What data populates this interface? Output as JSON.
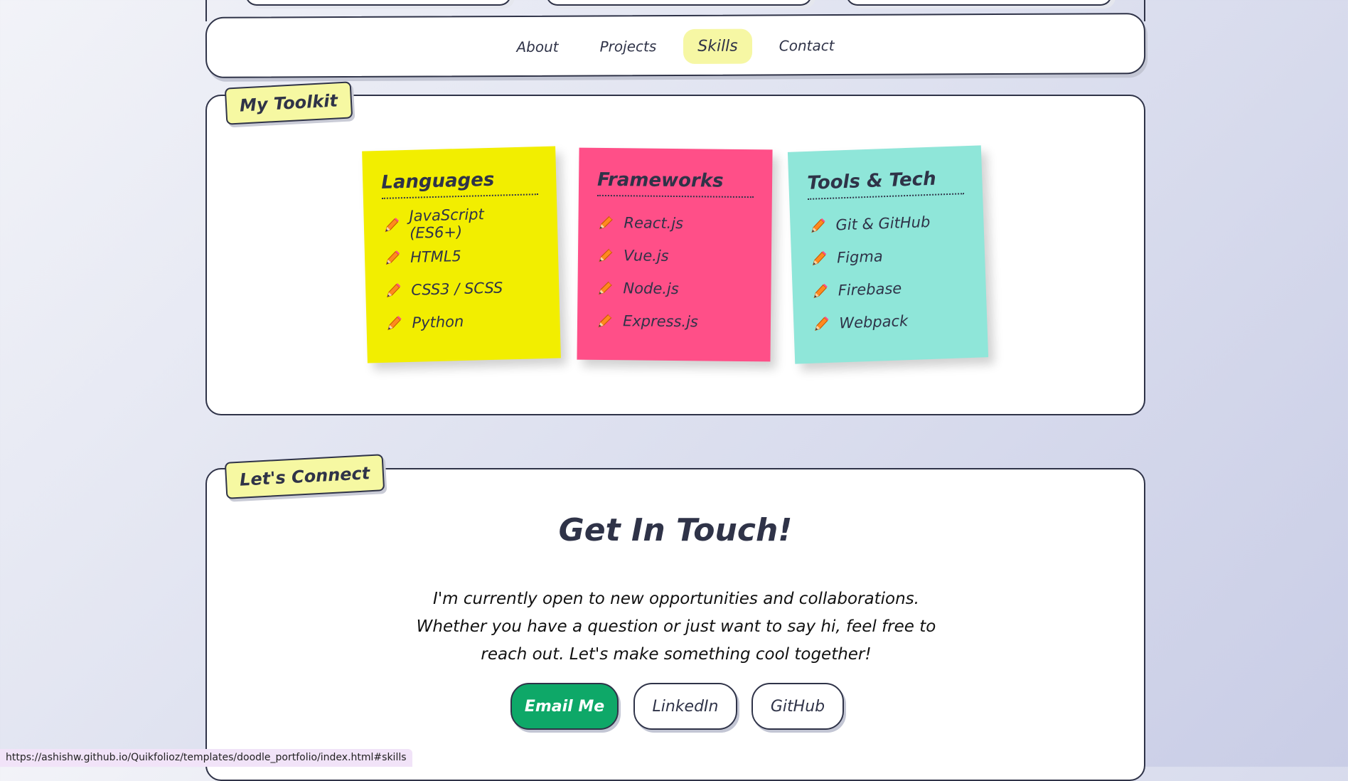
{
  "nav": {
    "links": [
      {
        "label": "About"
      },
      {
        "label": "Projects"
      },
      {
        "label": "Skills",
        "active": true
      },
      {
        "label": "Contact"
      }
    ]
  },
  "toolkit": {
    "tag": "My Toolkit",
    "notes": [
      {
        "title": "Languages",
        "color": "#f2ee00",
        "items": [
          "JavaScript (ES6+)",
          "HTML5",
          "CSS3 / SCSS",
          "Python"
        ]
      },
      {
        "title": "Frameworks",
        "color": "#ff4f88",
        "items": [
          "React.js",
          "Vue.js",
          "Node.js",
          "Express.js"
        ]
      },
      {
        "title": "Tools & Tech",
        "color": "#8fe6d9",
        "items": [
          "Git & GitHub",
          "Figma",
          "Firebase",
          "Webpack"
        ]
      }
    ],
    "item_icon": "pencil-icon"
  },
  "connect": {
    "tag": "Let's Connect",
    "title": "Get In Touch!",
    "blurb": "I'm currently open to new opportunities and collaborations. Whether you have a question or just want to say hi, feel free to reach out. Let's make something cool together!",
    "buttons": {
      "email": "Email Me",
      "linkedin": "LinkedIn",
      "github": "GitHub"
    }
  },
  "status_bar": {
    "url": "https://ashishw.github.io/Quikfolioz/templates/doodle_portfolio/index.html#skills"
  },
  "colors": {
    "accent_green": "#0ea868",
    "highlight_yellow": "#f6f7a4",
    "ink": "#2f3348"
  }
}
